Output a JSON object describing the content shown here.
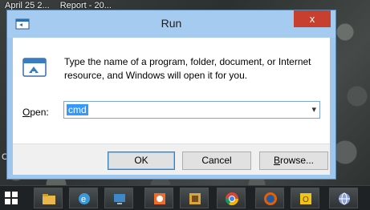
{
  "desktop": {
    "top_text": [
      "April 25 2...",
      "Report - 20..."
    ],
    "left_mark": "C"
  },
  "dialog": {
    "title": "Run",
    "close_label": "x",
    "description": "Type the name of a program, folder, document, or Internet resource, and Windows will open it for you.",
    "open_label_prefix": "",
    "open_label_accel": "O",
    "open_label_rest": "pen:",
    "open_value": "cmd",
    "buttons": {
      "ok": "OK",
      "cancel": "Cancel",
      "browse_accel": "B",
      "browse_rest": "rowse..."
    }
  },
  "taskbar": {
    "items": [
      {
        "name": "file-explorer-icon",
        "color": "#e8b94a"
      },
      {
        "name": "internet-explorer-icon",
        "color": "#3a9ad9"
      },
      {
        "name": "network-icon",
        "color": "#3c88c9"
      },
      {
        "name": "office-icon",
        "color": "#f16b2a"
      },
      {
        "name": "media-icon",
        "color": "#d9a540"
      },
      {
        "name": "chrome-icon",
        "color": "#3aa757"
      },
      {
        "name": "firefox-icon",
        "color": "#e66000"
      },
      {
        "name": "outlook-icon",
        "color": "#f0c419"
      },
      {
        "name": "globe-icon",
        "color": "#8aa0d8"
      }
    ]
  }
}
